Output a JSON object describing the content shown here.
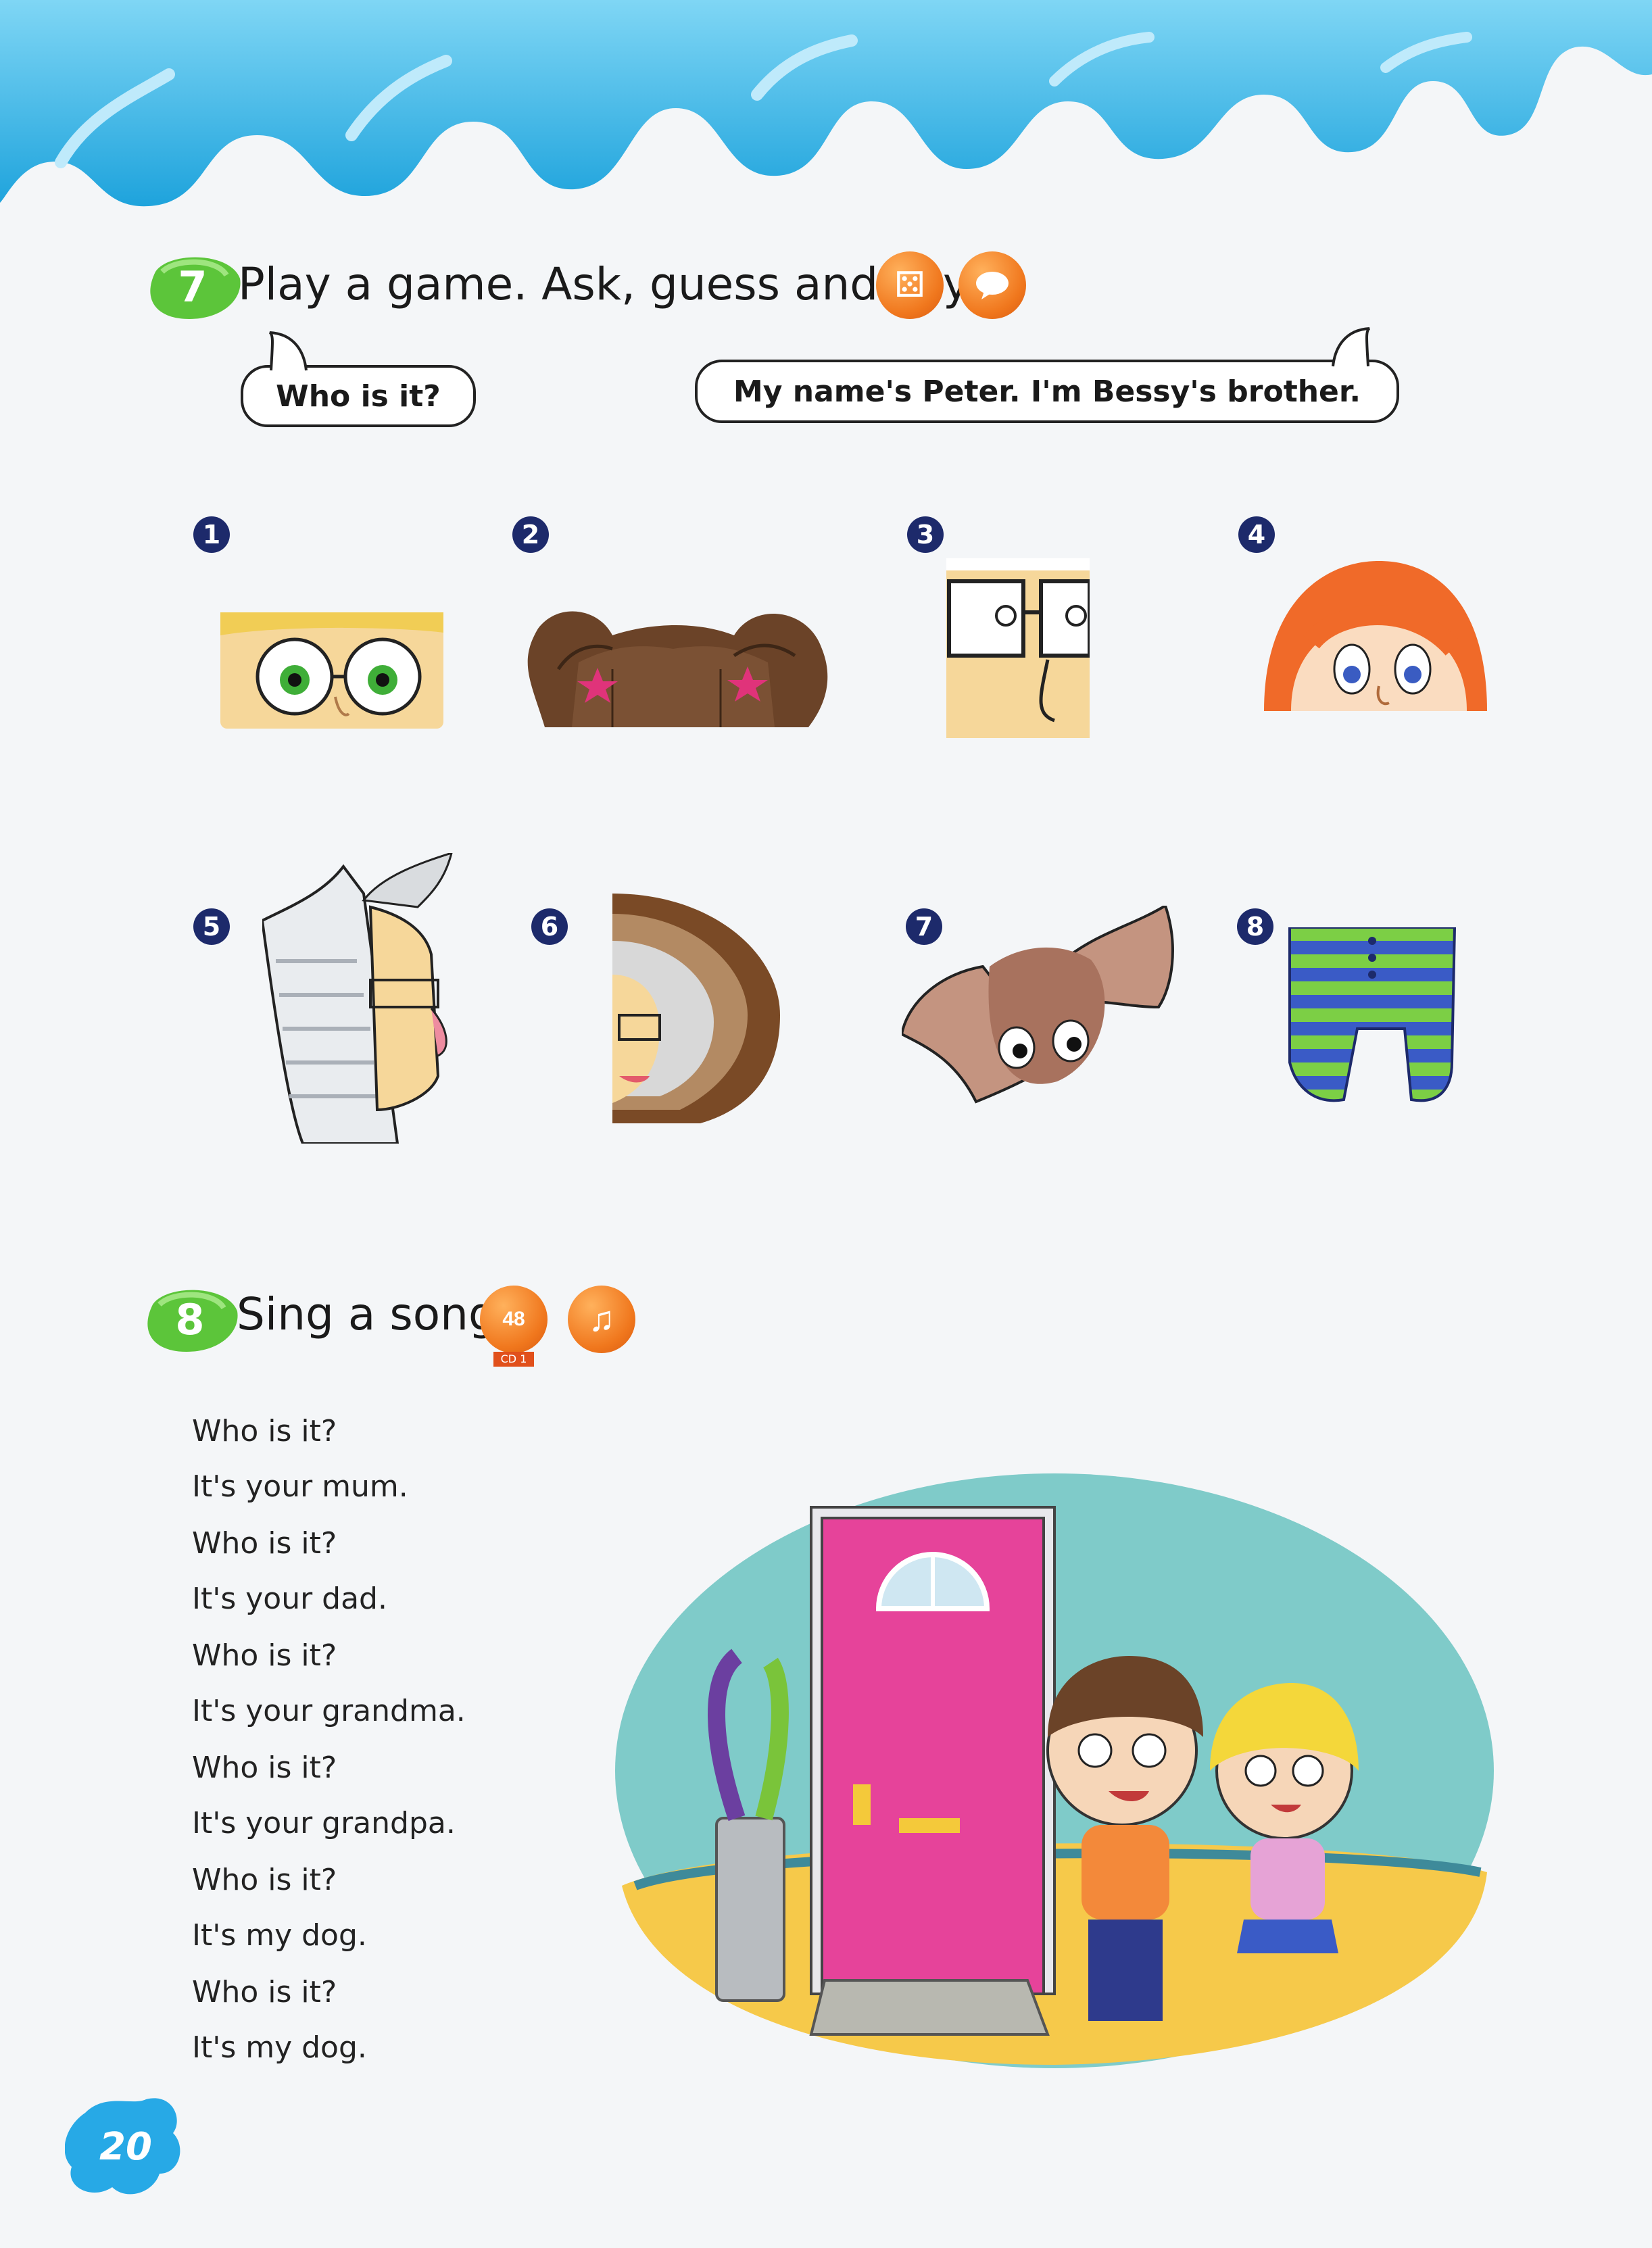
{
  "exercise7": {
    "number": "7",
    "title": "Play a game. Ask, guess and say.",
    "bubble_left": "Who is it?",
    "bubble_right": "My name's Peter. I'm Bessy's brother.",
    "items": [
      "1",
      "2",
      "3",
      "4",
      "5",
      "6",
      "7",
      "8"
    ],
    "icons": [
      "dice-icon",
      "speech-icon"
    ]
  },
  "exercise8": {
    "number": "8",
    "title": "Sing a song.",
    "track": "48",
    "cd_label": "CD 1",
    "lyrics": [
      "Who is it?",
      "It's your mum.",
      "Who is it?",
      "It's your dad.",
      "Who is it?",
      "It's your grandma.",
      "Who is it?",
      "It's your grandpa.",
      "Who is it?",
      "It's my dog.",
      "Who is it?",
      "It's my dog."
    ]
  },
  "page_number": "20",
  "colors": {
    "wave": "#3bb6e6",
    "exercise_badge": "#5cc53a",
    "icon_orange": "#f0771d",
    "number_dot": "#1d2a6b",
    "door": "#e6439a",
    "page_num_blue": "#27a9e6"
  }
}
